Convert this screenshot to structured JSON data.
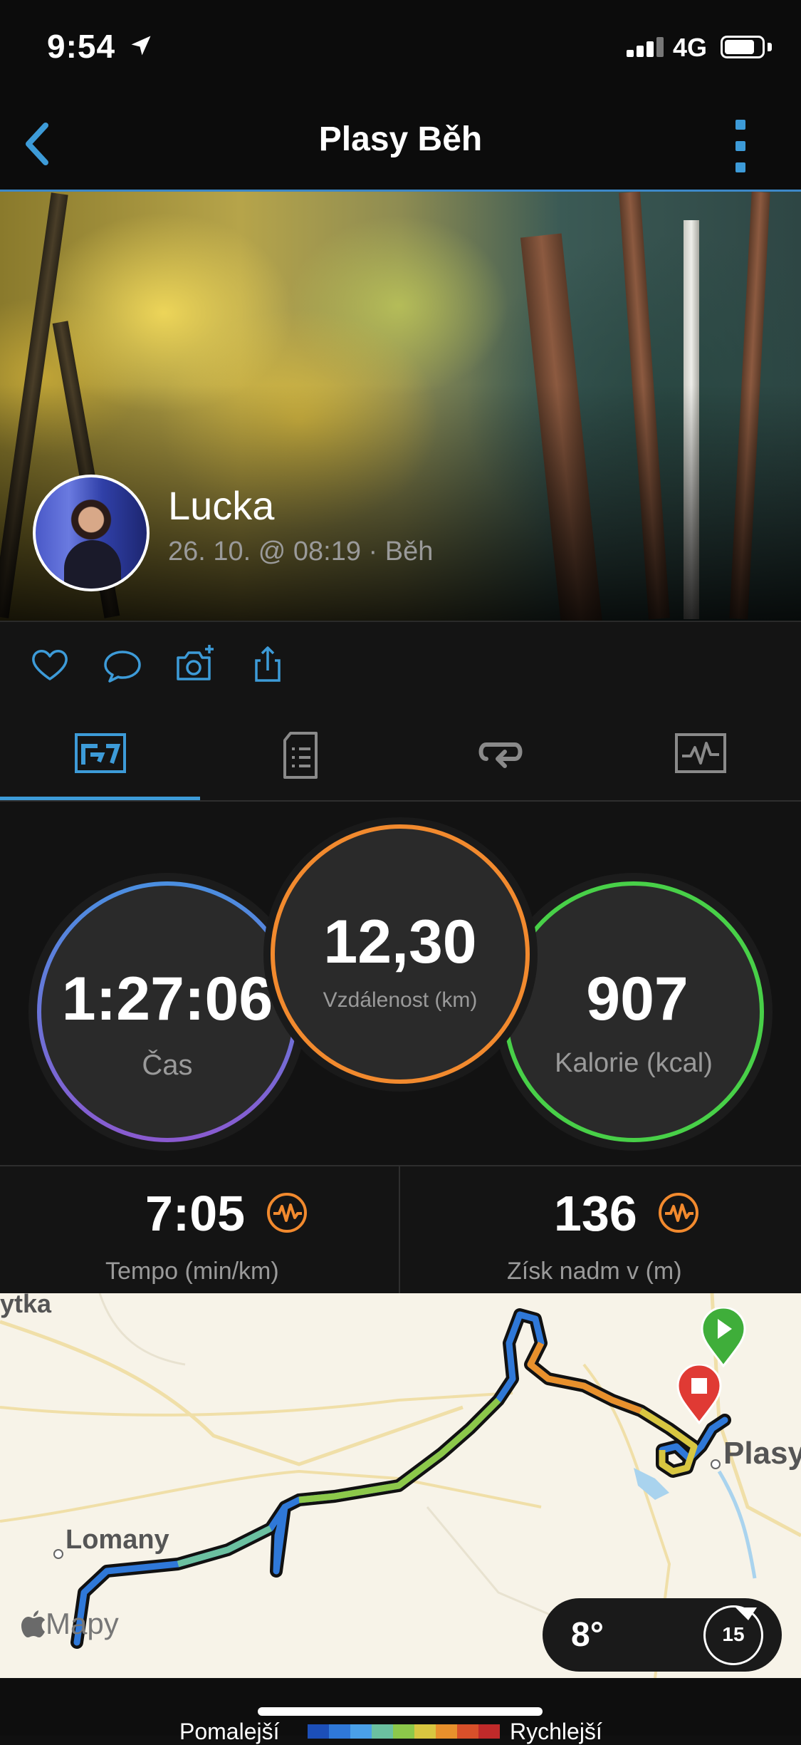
{
  "status": {
    "time": "9:54",
    "network": "4G"
  },
  "nav": {
    "title": "Plasy Běh"
  },
  "activity": {
    "user_name": "Lucka",
    "meta": "26. 10. @ 08:19 · Běh"
  },
  "rings": {
    "time": {
      "value": "1:27:06",
      "label": "Čas"
    },
    "distance": {
      "value": "12,30",
      "label": "Vzdálenost (km)"
    },
    "calories": {
      "value": "907",
      "label": "Kalorie (kcal)"
    }
  },
  "stats": {
    "pace": {
      "value": "7:05",
      "label": "Tempo (min/km)"
    },
    "elevation": {
      "value": "136",
      "label": "Získ nadm v (m)"
    }
  },
  "map": {
    "labels": {
      "top_left": "ytka",
      "town_left": "Lomany",
      "town_right": "Plasy"
    },
    "attribution": "Mapy",
    "weather": {
      "temp": "8°",
      "wind": "15"
    }
  },
  "legend": {
    "slow": "Pomalejší",
    "fast": "Rychlejší",
    "colors": [
      "#1c4fb8",
      "#2f78d8",
      "#4aa0e8",
      "#6bc0a0",
      "#8cc84a",
      "#d8c640",
      "#e8902c",
      "#d8502a",
      "#c02a2a"
    ]
  },
  "colors": {
    "accent": "#3d9bd8",
    "ring_distance": "#f28a2e",
    "ring_calories": "#48d048",
    "ring_time_start": "#4a8fe0",
    "ring_time_end": "#8a5ad0"
  }
}
